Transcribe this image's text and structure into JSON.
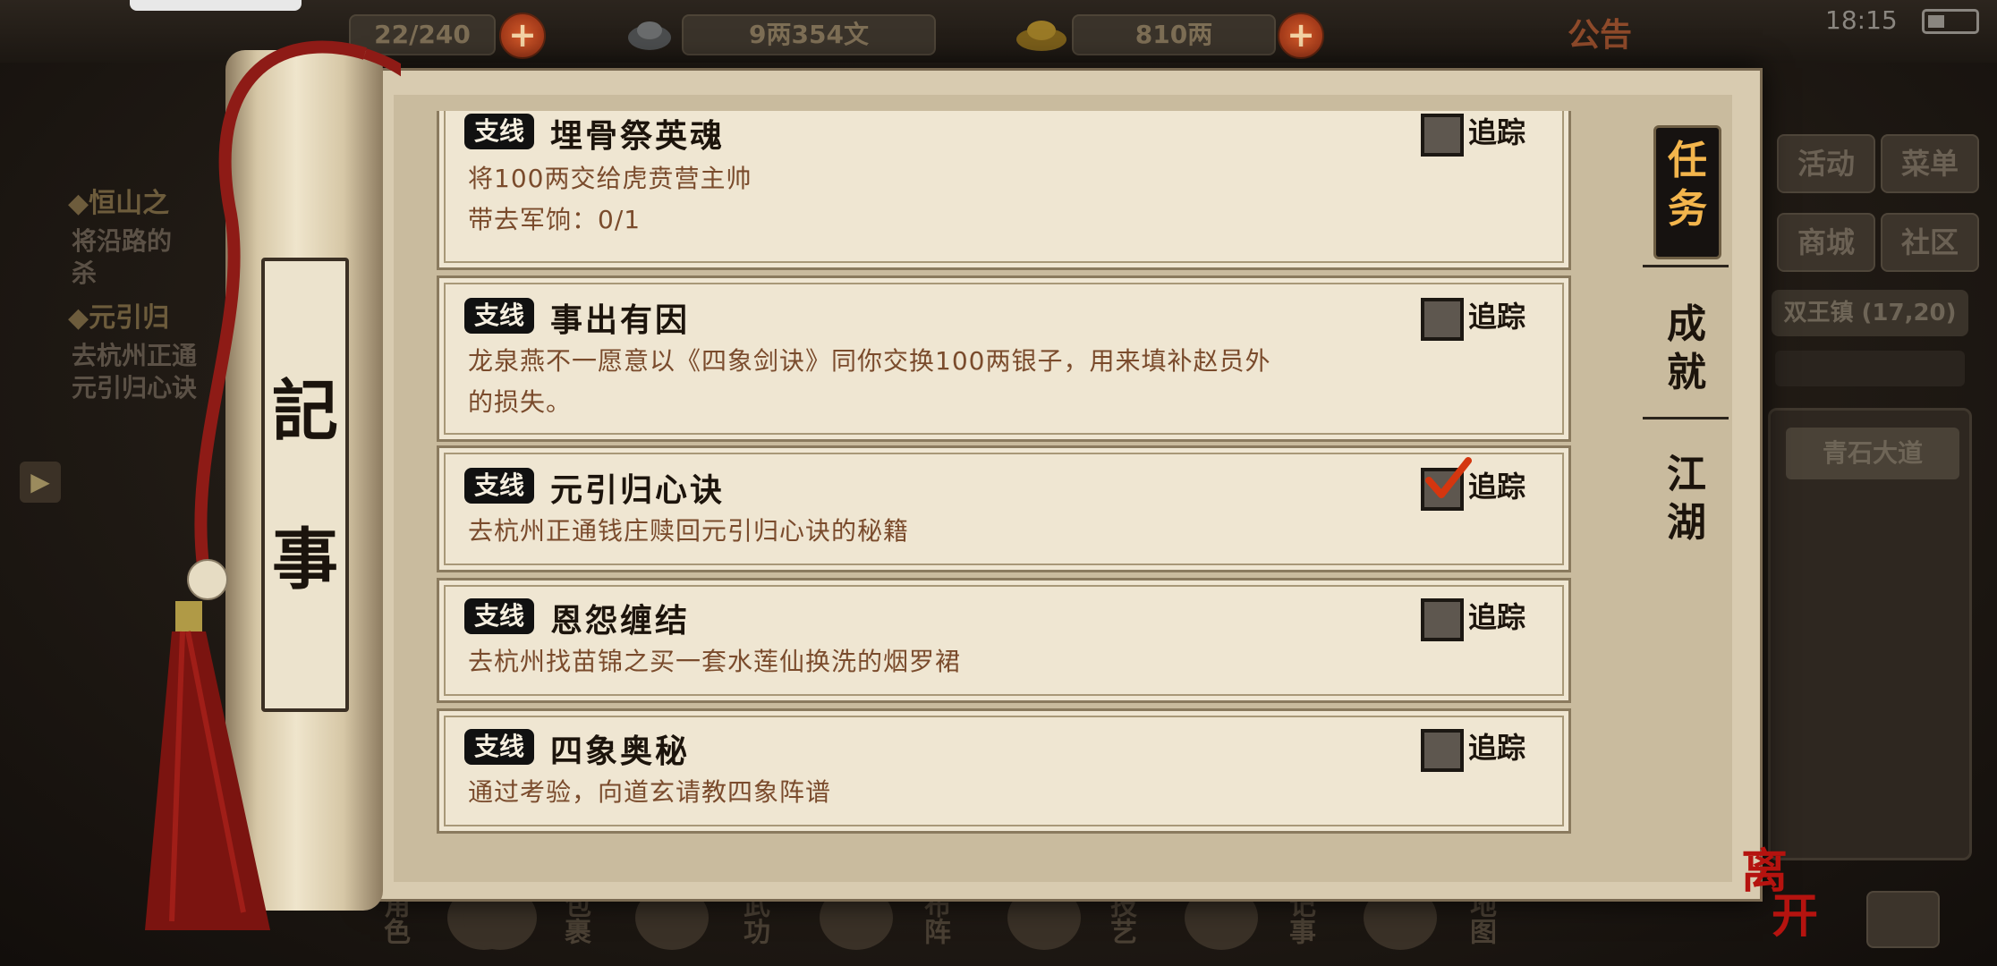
{
  "status": {
    "time": "18:15"
  },
  "topbar": {
    "bag_count": "22/240",
    "silver": "9两354文",
    "gold": "810两",
    "notice_label": "公告"
  },
  "left_tracker": {
    "quest1_title": "◆恒山之",
    "quest1_desc_line1": "将沿路的",
    "quest1_desc_line2": "杀",
    "quest2_title": "◆元引归",
    "quest2_desc_line1": "去杭州正通",
    "quest2_desc_line2": "元引归心诀"
  },
  "right_panel": {
    "btn_activity": "活动",
    "btn_menu": "菜单",
    "btn_shop": "商城",
    "btn_community": "社区",
    "town": "双王镇 (17,20)",
    "place": "青石大道"
  },
  "bottom_nav": {
    "role": "角色",
    "bag": "包裹",
    "martial": "武功",
    "formation": "布阵",
    "skill": "技艺",
    "journal": "记事",
    "map": "地图"
  },
  "journal": {
    "rod_label_1": "記",
    "rod_label_2": "事",
    "tabs": [
      {
        "label_1": "任",
        "label_2": "务"
      },
      {
        "label_1": "成",
        "label_2": "就"
      },
      {
        "label_1": "江",
        "label_2": "湖"
      }
    ],
    "badge": "支线",
    "track_label": "追踪",
    "quests": [
      {
        "title": "埋骨祭英魂",
        "desc_line1": "将100两交给虎贲营主帅",
        "desc_line2": "带去军饷：0/1",
        "tracked": false
      },
      {
        "title": "事出有因",
        "desc_line1": "龙泉燕不一愿意以《四象剑诀》同你交换100两银子，用来填补赵员外",
        "desc_line2": "的损失。",
        "tracked": false
      },
      {
        "title": "元引归心诀",
        "desc_line1": "去杭州正通钱庄赎回元引归心诀的秘籍",
        "tracked": true
      },
      {
        "title": "恩怨缠结",
        "desc_line1": "去杭州找苗锦之买一套水莲仙换洗的烟罗裙",
        "tracked": false
      },
      {
        "title": "四象奥秘",
        "desc_line1": "通过考验，向道玄请教四象阵谱",
        "tracked": false
      }
    ],
    "leave_label_1": "离",
    "leave_label_2": "开"
  }
}
